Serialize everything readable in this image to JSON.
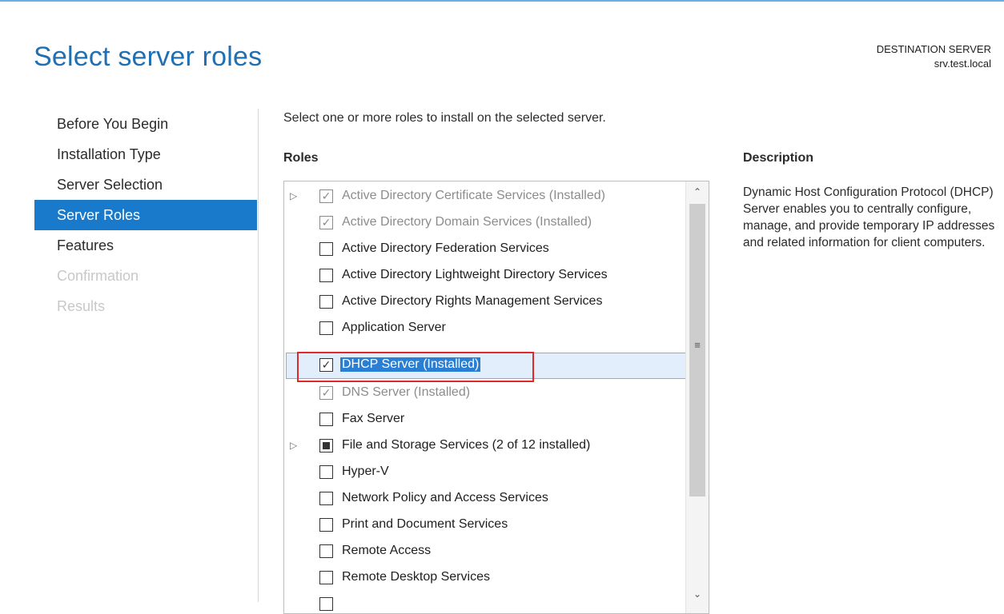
{
  "header": {
    "title": "Select server roles",
    "destination_label": "DESTINATION SERVER",
    "destination_name": "srv.test.local"
  },
  "nav": {
    "items": [
      {
        "label": "Before You Begin",
        "state": "normal"
      },
      {
        "label": "Installation Type",
        "state": "normal"
      },
      {
        "label": "Server Selection",
        "state": "normal"
      },
      {
        "label": "Server Roles",
        "state": "selected"
      },
      {
        "label": "Features",
        "state": "normal"
      },
      {
        "label": "Confirmation",
        "state": "disabled"
      },
      {
        "label": "Results",
        "state": "disabled"
      }
    ]
  },
  "main": {
    "instruction": "Select one or more roles to install on the selected server.",
    "roles_heading": "Roles",
    "roles": [
      {
        "label": "Active Directory Certificate Services (Installed)",
        "checked": true,
        "installed": true,
        "expandable": true
      },
      {
        "label": "Active Directory Domain Services (Installed)",
        "checked": true,
        "installed": true,
        "expandable": false
      },
      {
        "label": "Active Directory Federation Services",
        "checked": false,
        "installed": false,
        "expandable": false
      },
      {
        "label": "Active Directory Lightweight Directory Services",
        "checked": false,
        "installed": false,
        "expandable": false
      },
      {
        "label": "Active Directory Rights Management Services",
        "checked": false,
        "installed": false,
        "expandable": false
      },
      {
        "label": "Application Server",
        "checked": false,
        "installed": false,
        "expandable": false
      },
      {
        "label": "DHCP Server (Installed)",
        "checked": true,
        "installed": true,
        "expandable": false,
        "selected": true
      },
      {
        "label": "DNS Server (Installed)",
        "checked": true,
        "installed": true,
        "expandable": false
      },
      {
        "label": "Fax Server",
        "checked": false,
        "installed": false,
        "expandable": false
      },
      {
        "label": "File and Storage Services (2 of 12 installed)",
        "checked": "partial",
        "installed": false,
        "expandable": true
      },
      {
        "label": "Hyper-V",
        "checked": false,
        "installed": false,
        "expandable": false
      },
      {
        "label": "Network Policy and Access Services",
        "checked": false,
        "installed": false,
        "expandable": false
      },
      {
        "label": "Print and Document Services",
        "checked": false,
        "installed": false,
        "expandable": false
      },
      {
        "label": "Remote Access",
        "checked": false,
        "installed": false,
        "expandable": false
      },
      {
        "label": "Remote Desktop Services",
        "checked": false,
        "installed": false,
        "expandable": false
      }
    ]
  },
  "description": {
    "heading": "Description",
    "text": "Dynamic Host Configuration Protocol (DHCP) Server enables you to centrally configure, manage, and provide temporary IP addresses and related information for client computers."
  },
  "colors": {
    "title": "#1f6fb2",
    "nav_selected_bg": "#1979ca",
    "highlight_bg": "#2a7fd4",
    "callout_border": "#e0282c"
  },
  "icons": {
    "expander": "chevron-right-icon",
    "check": "checkmark-icon",
    "scroll_up": "chevron-up-icon",
    "scroll_down": "chevron-down-icon"
  }
}
